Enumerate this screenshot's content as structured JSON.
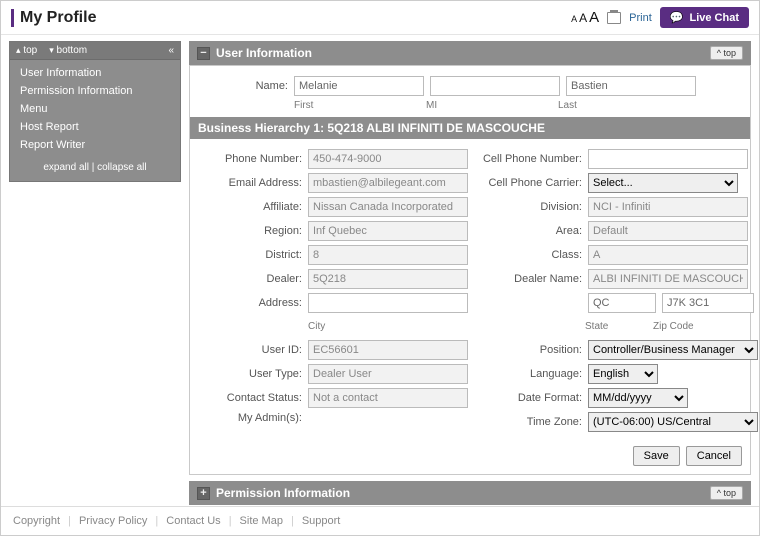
{
  "header": {
    "title": "My Profile",
    "print": "Print",
    "livechat": "Live Chat"
  },
  "sidebar": {
    "top_label": "top",
    "bottom_label": "bottom",
    "items": [
      "User Information",
      "Permission Information",
      "Menu",
      "Host Report",
      "Report Writer"
    ],
    "expand": "expand all",
    "collapse": "collapse all"
  },
  "section_user_info": {
    "title": "User Information",
    "top_btn": "^ top",
    "name_label": "Name:",
    "first": "Melanie",
    "mi": "",
    "last": "Bastien",
    "first_lbl": "First",
    "mi_lbl": "MI",
    "last_lbl": "Last",
    "subheader": "Business Hierarchy 1: 5Q218 ALBI INFINITI DE MASCOUCHE"
  },
  "left_fields": {
    "phone_lbl": "Phone Number:",
    "phone": "450-474-9000",
    "email_lbl": "Email Address:",
    "email": "mbastien@albilegeant.com",
    "affiliate_lbl": "Affiliate:",
    "affiliate": "Nissan Canada Incorporated",
    "region_lbl": "Region:",
    "region": "Inf Quebec",
    "district_lbl": "District:",
    "district": "8",
    "dealer_lbl": "Dealer:",
    "dealer": "5Q218",
    "address_lbl": "Address:",
    "city": "",
    "state": "QC",
    "zip": "J7K 3C1",
    "city_lbl": "City",
    "state_lbl": "State",
    "zip_lbl": "Zip Code",
    "userid_lbl": "User ID:",
    "userid": "EC56601",
    "usertype_lbl": "User Type:",
    "usertype": "Dealer User",
    "contact_lbl": "Contact Status:",
    "contact": "Not a contact",
    "myadmins_lbl": "My Admin(s):"
  },
  "right_fields": {
    "cellnum_lbl": "Cell Phone Number:",
    "cellnum": "",
    "cellcarrier_lbl": "Cell Phone Carrier:",
    "cellcarrier": "Select...",
    "division_lbl": "Division:",
    "division": "NCI - Infiniti",
    "area_lbl": "Area:",
    "area": "Default",
    "class_lbl": "Class:",
    "class": "A",
    "dealername_lbl": "Dealer Name:",
    "dealername": "ALBI INFINITI DE MASCOUCHE",
    "position_lbl": "Position:",
    "position": "Controller/Business Manager",
    "language_lbl": "Language:",
    "language": "English",
    "dateformat_lbl": "Date Format:",
    "dateformat": "MM/dd/yyyy",
    "timezone_lbl": "Time Zone:",
    "timezone": "(UTC-06:00) US/Central"
  },
  "buttons": {
    "save": "Save",
    "cancel": "Cancel"
  },
  "section_perm": {
    "title": "Permission Information",
    "top_btn": "^ top"
  },
  "footer": {
    "copyright": "Copyright",
    "privacy": "Privacy Policy",
    "contact": "Contact Us",
    "sitemap": "Site Map",
    "support": "Support"
  }
}
